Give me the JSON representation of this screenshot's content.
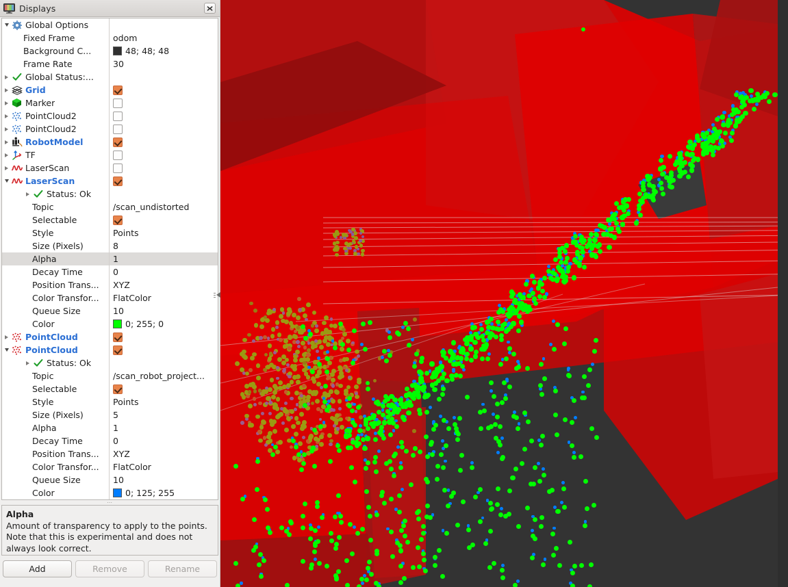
{
  "panel": {
    "title": "Displays",
    "title_icon": "display-monitor-icon",
    "close_icon": "close-icon"
  },
  "tree": {
    "rows": [
      {
        "id": "global-options",
        "indent": 1,
        "arrow": "down",
        "icon": "gear-icon",
        "label": "Global Options",
        "label_style": "plain",
        "value_type": "none",
        "value": ""
      },
      {
        "id": "fixed-frame",
        "indent": 2,
        "arrow": "none",
        "icon": "none",
        "label": "Fixed Frame",
        "label_style": "plain",
        "value_type": "text",
        "value": "odom"
      },
      {
        "id": "background-color",
        "indent": 2,
        "arrow": "none",
        "icon": "none",
        "label": "Background C...",
        "label_style": "plain",
        "value_type": "color",
        "value": "48; 48; 48",
        "swatch": "#303030"
      },
      {
        "id": "frame-rate",
        "indent": 2,
        "arrow": "none",
        "icon": "none",
        "label": "Frame Rate",
        "label_style": "plain",
        "value_type": "text",
        "value": "30"
      },
      {
        "id": "global-status",
        "indent": 1,
        "arrow": "right",
        "icon": "check-icon",
        "label": "Global Status:...",
        "label_style": "plain",
        "value_type": "none",
        "value": ""
      },
      {
        "id": "grid",
        "indent": 1,
        "arrow": "right",
        "icon": "grid-icon",
        "label": "Grid",
        "label_style": "blue",
        "value_type": "checkbox",
        "value": "checked"
      },
      {
        "id": "marker",
        "indent": 1,
        "arrow": "right",
        "icon": "marker-cube-icon",
        "label": "Marker",
        "label_style": "plain",
        "value_type": "checkbox",
        "value": "unchecked"
      },
      {
        "id": "pointcloud2-1",
        "indent": 1,
        "arrow": "right",
        "icon": "pointcloud2-icon",
        "label": "PointCloud2",
        "label_style": "plain",
        "value_type": "checkbox",
        "value": "unchecked"
      },
      {
        "id": "pointcloud2-2",
        "indent": 1,
        "arrow": "right",
        "icon": "pointcloud2-icon",
        "label": "PointCloud2",
        "label_style": "plain",
        "value_type": "checkbox",
        "value": "unchecked"
      },
      {
        "id": "robotmodel",
        "indent": 1,
        "arrow": "right",
        "icon": "robotmodel-icon",
        "label": "RobotModel",
        "label_style": "blue",
        "value_type": "checkbox",
        "value": "checked"
      },
      {
        "id": "tf",
        "indent": 1,
        "arrow": "right",
        "icon": "tf-axes-icon",
        "label": "TF",
        "label_style": "plain",
        "value_type": "checkbox",
        "value": "unchecked"
      },
      {
        "id": "laserscan-1",
        "indent": 1,
        "arrow": "right",
        "icon": "laserscan-icon",
        "label": "LaserScan",
        "label_style": "plain",
        "value_type": "checkbox",
        "value": "unchecked"
      },
      {
        "id": "laserscan-2",
        "indent": 1,
        "arrow": "down",
        "icon": "laserscan-icon",
        "label": "LaserScan",
        "label_style": "blue",
        "value_type": "checkbox",
        "value": "checked"
      },
      {
        "id": "laserscan-status",
        "indent": 3,
        "arrow": "right",
        "icon": "check-icon",
        "label": "Status: Ok",
        "label_style": "plain",
        "value_type": "none",
        "value": ""
      },
      {
        "id": "laserscan-topic",
        "indent": 3,
        "arrow": "none",
        "icon": "none",
        "label": "Topic",
        "label_style": "plain",
        "value_type": "text",
        "value": "/scan_undistorted"
      },
      {
        "id": "laserscan-selectable",
        "indent": 3,
        "arrow": "none",
        "icon": "none",
        "label": "Selectable",
        "label_style": "plain",
        "value_type": "checkbox",
        "value": "checked"
      },
      {
        "id": "laserscan-style",
        "indent": 3,
        "arrow": "none",
        "icon": "none",
        "label": "Style",
        "label_style": "plain",
        "value_type": "text",
        "value": "Points"
      },
      {
        "id": "laserscan-size",
        "indent": 3,
        "arrow": "none",
        "icon": "none",
        "label": "Size (Pixels)",
        "label_style": "plain",
        "value_type": "text",
        "value": "8"
      },
      {
        "id": "laserscan-alpha",
        "indent": 3,
        "arrow": "none",
        "icon": "none",
        "label": "Alpha",
        "label_style": "plain",
        "value_type": "text",
        "value": "1",
        "selected": true
      },
      {
        "id": "laserscan-decay",
        "indent": 3,
        "arrow": "none",
        "icon": "none",
        "label": "Decay Time",
        "label_style": "plain",
        "value_type": "text",
        "value": "0"
      },
      {
        "id": "laserscan-postrans",
        "indent": 3,
        "arrow": "none",
        "icon": "none",
        "label": "Position Trans...",
        "label_style": "plain",
        "value_type": "text",
        "value": "XYZ"
      },
      {
        "id": "laserscan-colortrans",
        "indent": 3,
        "arrow": "none",
        "icon": "none",
        "label": "Color Transfor...",
        "label_style": "plain",
        "value_type": "text",
        "value": "FlatColor"
      },
      {
        "id": "laserscan-queue",
        "indent": 3,
        "arrow": "none",
        "icon": "none",
        "label": "Queue Size",
        "label_style": "plain",
        "value_type": "text",
        "value": "10"
      },
      {
        "id": "laserscan-color",
        "indent": 3,
        "arrow": "none",
        "icon": "none",
        "label": "Color",
        "label_style": "plain",
        "value_type": "color",
        "value": "0; 255; 0",
        "swatch": "#00ff00"
      },
      {
        "id": "pointcloud-1",
        "indent": 1,
        "arrow": "right",
        "icon": "pointcloud-icon",
        "label": "PointCloud",
        "label_style": "blue",
        "value_type": "checkbox",
        "value": "checked"
      },
      {
        "id": "pointcloud-2",
        "indent": 1,
        "arrow": "down",
        "icon": "pointcloud-icon",
        "label": "PointCloud",
        "label_style": "blue",
        "value_type": "checkbox",
        "value": "checked"
      },
      {
        "id": "pointcloud-status",
        "indent": 3,
        "arrow": "right",
        "icon": "check-icon",
        "label": "Status: Ok",
        "label_style": "plain",
        "value_type": "none",
        "value": ""
      },
      {
        "id": "pointcloud-topic",
        "indent": 3,
        "arrow": "none",
        "icon": "none",
        "label": "Topic",
        "label_style": "plain",
        "value_type": "text",
        "value": "/scan_robot_project..."
      },
      {
        "id": "pointcloud-selectable",
        "indent": 3,
        "arrow": "none",
        "icon": "none",
        "label": "Selectable",
        "label_style": "plain",
        "value_type": "checkbox",
        "value": "checked"
      },
      {
        "id": "pointcloud-style",
        "indent": 3,
        "arrow": "none",
        "icon": "none",
        "label": "Style",
        "label_style": "plain",
        "value_type": "text",
        "value": "Points"
      },
      {
        "id": "pointcloud-size",
        "indent": 3,
        "arrow": "none",
        "icon": "none",
        "label": "Size (Pixels)",
        "label_style": "plain",
        "value_type": "text",
        "value": "5"
      },
      {
        "id": "pointcloud-alpha",
        "indent": 3,
        "arrow": "none",
        "icon": "none",
        "label": "Alpha",
        "label_style": "plain",
        "value_type": "text",
        "value": "1"
      },
      {
        "id": "pointcloud-decay",
        "indent": 3,
        "arrow": "none",
        "icon": "none",
        "label": "Decay Time",
        "label_style": "plain",
        "value_type": "text",
        "value": "0"
      },
      {
        "id": "pointcloud-postrans",
        "indent": 3,
        "arrow": "none",
        "icon": "none",
        "label": "Position Trans...",
        "label_style": "plain",
        "value_type": "text",
        "value": "XYZ"
      },
      {
        "id": "pointcloud-colortrans",
        "indent": 3,
        "arrow": "none",
        "icon": "none",
        "label": "Color Transfor...",
        "label_style": "plain",
        "value_type": "text",
        "value": "FlatColor"
      },
      {
        "id": "pointcloud-queue",
        "indent": 3,
        "arrow": "none",
        "icon": "none",
        "label": "Queue Size",
        "label_style": "plain",
        "value_type": "text",
        "value": "10"
      },
      {
        "id": "pointcloud-color",
        "indent": 3,
        "arrow": "none",
        "icon": "none",
        "label": "Color",
        "label_style": "plain",
        "value_type": "color",
        "value": "0; 125; 255",
        "swatch": "#007dff"
      }
    ]
  },
  "description": {
    "title": "Alpha",
    "body": "Amount of transparency to apply to the points. Note that this is experimental and does not always look correct."
  },
  "buttons": {
    "add": "Add",
    "remove": "Remove",
    "rename": "Rename"
  },
  "viewport": {
    "background_color": "#333333",
    "robot_model_color": "#e00000",
    "laserscan_color": "#00ff00",
    "pointcloud_color": "#007dff",
    "grid_line_color": "#cfcfcf"
  }
}
